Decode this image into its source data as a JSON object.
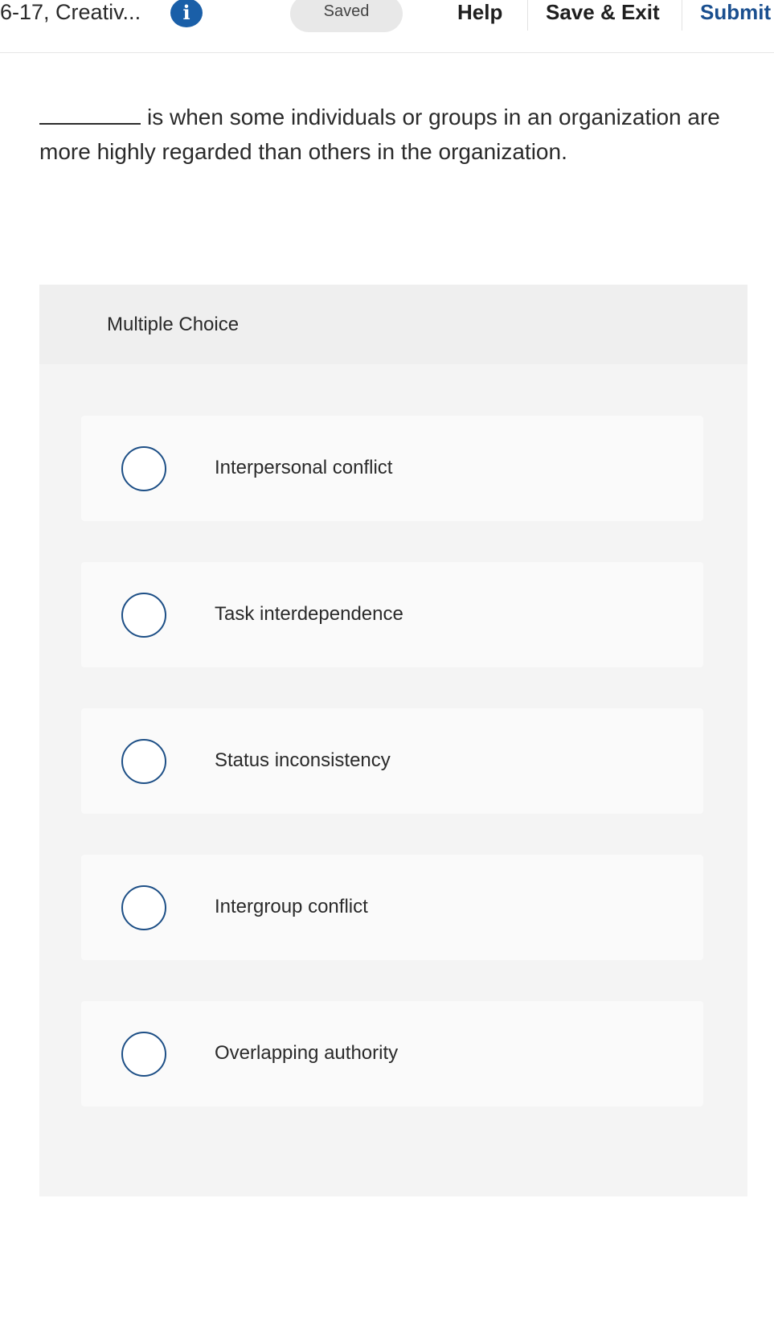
{
  "header": {
    "assignment_title": "6-17, Creativ...",
    "info_icon": "info-icon",
    "info_glyph": "i",
    "saved_label": "Saved",
    "help_label": "Help",
    "save_exit_label": "Save & Exit",
    "submit_label": "Submit"
  },
  "question": {
    "text": "is when some individuals or groups in an organization are more highly regarded than others in the organization."
  },
  "multiple_choice": {
    "label": "Multiple Choice",
    "options": [
      {
        "label": "Interpersonal conflict"
      },
      {
        "label": "Task interdependence"
      },
      {
        "label": "Status inconsistency"
      },
      {
        "label": "Intergroup conflict"
      },
      {
        "label": "Overlapping authority"
      }
    ]
  },
  "colors": {
    "accent": "#1a5fa8",
    "radio_border": "#1d4f86",
    "panel_bg": "#f4f4f4",
    "option_bg": "#fafafa"
  }
}
